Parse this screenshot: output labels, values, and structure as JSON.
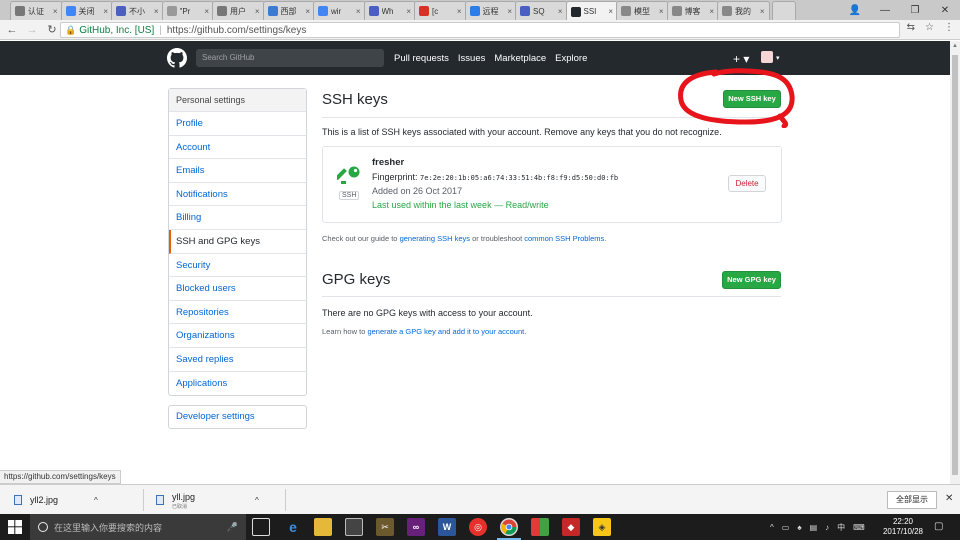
{
  "browser": {
    "tabs": [
      {
        "title": "认证",
        "color": "#777"
      },
      {
        "title": "关闭",
        "color": "#4285f4"
      },
      {
        "title": "不小",
        "color": "#4a5fc1"
      },
      {
        "title": "\"Pr",
        "color": "#999"
      },
      {
        "title": "用户",
        "color": "#777"
      },
      {
        "title": "西部",
        "color": "#3b7bd4"
      },
      {
        "title": "wir",
        "color": "#4285f4"
      },
      {
        "title": "Wh",
        "color": "#4a5fc1"
      },
      {
        "title": "[c",
        "color": "#d93025"
      },
      {
        "title": "远程",
        "color": "#2b7de9"
      },
      {
        "title": "SQ",
        "color": "#4a5fc1"
      },
      {
        "title": "SSI",
        "color": "#24292e",
        "active": true
      },
      {
        "title": "模型",
        "color": "#888"
      },
      {
        "title": "博客",
        "color": "#888"
      },
      {
        "title": "我的",
        "color": "#888"
      }
    ],
    "address": {
      "secure_label": "GitHub, Inc. [US]",
      "url": "https://github.com/settings/keys"
    },
    "status_url": "https://github.com/settings/keys"
  },
  "gh_header": {
    "search_placeholder": "Search GitHub",
    "nav": [
      "Pull requests",
      "Issues",
      "Marketplace",
      "Explore"
    ],
    "plus": "+ ▾"
  },
  "sidebar": {
    "heading": "Personal settings",
    "items": [
      "Profile",
      "Account",
      "Emails",
      "Notifications",
      "Billing",
      "SSH and GPG keys",
      "Security",
      "Blocked users",
      "Repositories",
      "Organizations",
      "Saved replies",
      "Applications"
    ],
    "selected": "SSH and GPG keys",
    "developer": "Developer settings"
  },
  "ssh": {
    "title": "SSH keys",
    "new_button": "New SSH key",
    "description": "This is a list of SSH keys associated with your account. Remove any keys that you do not recognize.",
    "key": {
      "name": "fresher",
      "fingerprint_label": "Fingerprint:",
      "fingerprint": "7e:2e:20:1b:05:a6:74:33:51:4b:f8:f9:d5:50:d0:fb",
      "added": "Added on 26 Oct 2017",
      "last_used": "Last used within the last week — Read/write",
      "type": "SSH",
      "delete": "Delete"
    },
    "guide": {
      "pre": "Check out our guide to ",
      "link1": "generating SSH keys",
      "mid": " or troubleshoot ",
      "link2": "common SSH Problems",
      "post": "."
    }
  },
  "gpg": {
    "title": "GPG keys",
    "new_button": "New GPG key",
    "empty": "There are no GPG keys with access to your account.",
    "learn_pre": "Learn how to ",
    "learn_link": "generate a GPG key and add it to your account",
    "learn_post": "."
  },
  "downloads": {
    "items": [
      {
        "name": "yll2.jpg"
      },
      {
        "name": "yll.jpg",
        "sub": "已取消"
      }
    ],
    "show_all": "全部显示"
  },
  "taskbar": {
    "search_placeholder": "在这里输入你要搜索的内容",
    "time": "22:20",
    "date": "2017/10/28",
    "ime": "中"
  }
}
